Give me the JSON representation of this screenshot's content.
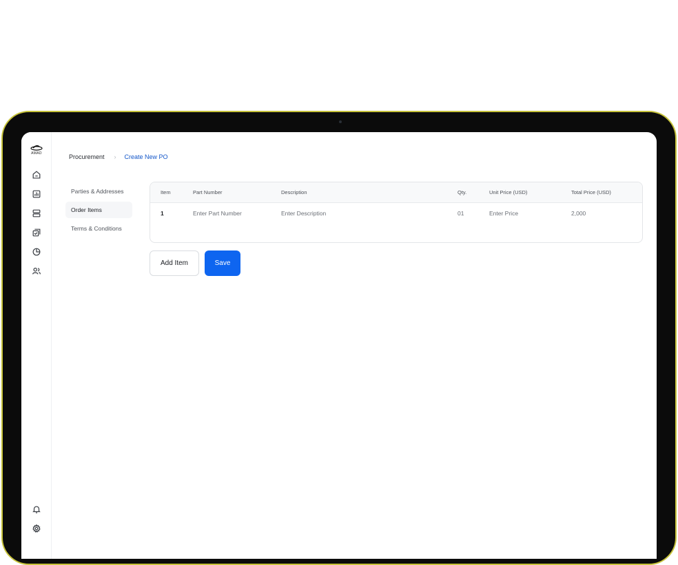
{
  "app": {
    "logo_text": "AMAD"
  },
  "sidebar": {
    "items": [
      {
        "icon": "home-icon"
      },
      {
        "icon": "chart-icon"
      },
      {
        "icon": "server-icon"
      },
      {
        "icon": "documents-icon"
      },
      {
        "icon": "pie-chart-icon"
      },
      {
        "icon": "users-icon"
      }
    ],
    "bottom": [
      {
        "icon": "bell-icon"
      },
      {
        "icon": "gear-icon"
      }
    ]
  },
  "breadcrumb": {
    "root": "Procurement",
    "separator": ">",
    "current": "Create New PO"
  },
  "subnav": {
    "items": [
      {
        "label": "Parties & Addresses",
        "active": false
      },
      {
        "label": "Order Items",
        "active": true
      },
      {
        "label": "Terms & Conditions",
        "active": false
      }
    ]
  },
  "table": {
    "headers": [
      "Item",
      "Part Number",
      "Description",
      "Qty.",
      "Unit Price (USD)",
      "Total Price (USD)"
    ],
    "rows": [
      [
        "1",
        "Enter Part Number",
        "Enter Description",
        "01",
        "Enter Price",
        "2,000"
      ]
    ]
  },
  "actions": {
    "add_item": "Add Item",
    "save": "Save"
  },
  "colors": {
    "accent": "#0e65f0",
    "breadcrumb_current": "#1457c9",
    "bezel_outline": "#c6c23a"
  }
}
